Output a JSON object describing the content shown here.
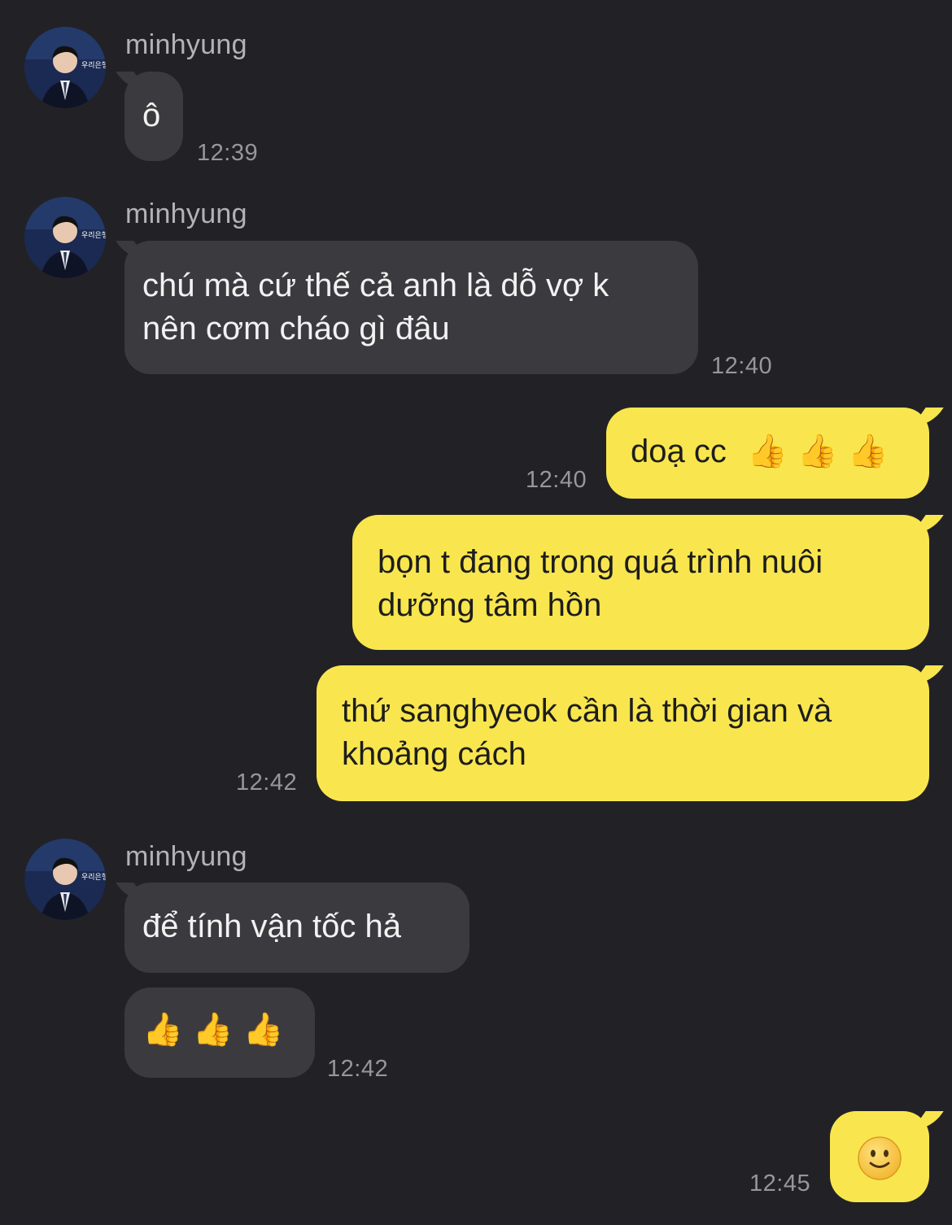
{
  "chat": {
    "contact_name": "minhyung",
    "messages": [
      {
        "id": "m1",
        "from": "them",
        "show_sender": true,
        "text": "ô",
        "time": "12:39"
      },
      {
        "id": "m2",
        "from": "them",
        "show_sender": true,
        "lines": [
          "chú mà cứ thế cả anh là dỗ vợ k",
          "nên cơm cháo gì đâu"
        ],
        "time": "12:40"
      },
      {
        "id": "m3",
        "from": "me",
        "text": "doạ cc",
        "emoji": "thumbs-up x3",
        "time": "12:40"
      },
      {
        "id": "m4",
        "from": "me",
        "lines": [
          "bọn t đang trong quá trình nuôi",
          "dưỡng tâm hồn"
        ]
      },
      {
        "id": "m5",
        "from": "me",
        "lines": [
          "thứ sanghyeok cần là thời gian và",
          "khoảng cách"
        ],
        "time": "12:42"
      },
      {
        "id": "m6",
        "from": "them",
        "show_sender": true,
        "text": "để tính vận tốc hả"
      },
      {
        "id": "m7",
        "from": "them",
        "emoji": "thumbs-up x3",
        "time": "12:42"
      },
      {
        "id": "m8",
        "from": "me",
        "emoji": "slightly-smiling-face",
        "time": "12:45"
      }
    ]
  },
  "avatar_badge_text": "우리은행",
  "colors": {
    "background": "#222226",
    "incoming_bubble": "#3b3b3f",
    "outgoing_bubble": "#f9e64e",
    "timestamp": "#97979a",
    "sender_name": "#b3b3b6"
  }
}
